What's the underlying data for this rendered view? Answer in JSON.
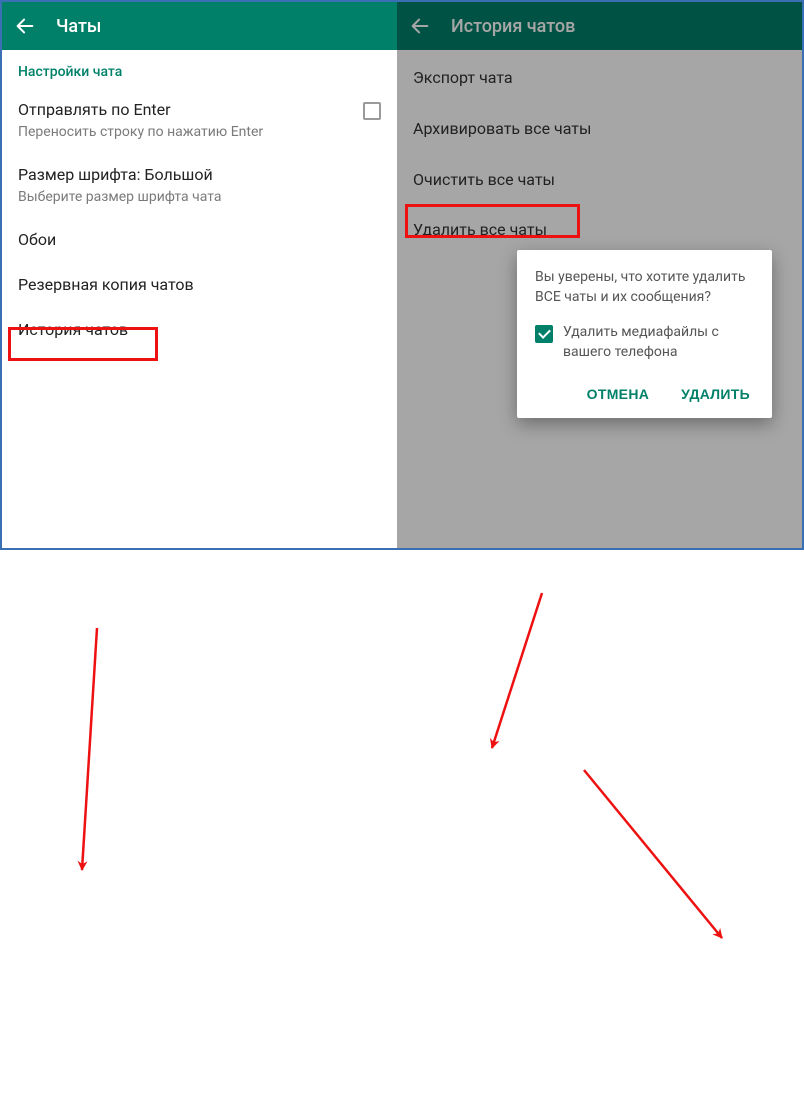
{
  "left": {
    "header": {
      "title": "Чаты"
    },
    "section": "Настройки чата",
    "rows": {
      "send_enter": {
        "title": "Отправлять по Enter",
        "sub": "Переносить строку по нажатию Enter"
      },
      "font": {
        "title": "Размер шрифта: Большой",
        "sub": "Выберите размер шрифта чата"
      },
      "wallpaper": {
        "title": "Обои"
      },
      "backup": {
        "title": "Резервная копия чатов"
      },
      "history": {
        "title": "История чатов"
      }
    }
  },
  "right": {
    "header": {
      "title": "История чатов"
    },
    "rows": {
      "export": {
        "title": "Экспорт чата"
      },
      "archive": {
        "title": "Архивировать все чаты"
      },
      "clear": {
        "title": "Очистить все чаты"
      },
      "delete": {
        "title": "Удалить все чаты"
      }
    },
    "dialog": {
      "message": "Вы уверены, что хотите удалить ВСЕ чаты и их сообщения?",
      "option": "Удалить медиафайлы с вашего телефона",
      "cancel": "ОТМЕНА",
      "confirm": "УДАЛИТЬ"
    }
  }
}
